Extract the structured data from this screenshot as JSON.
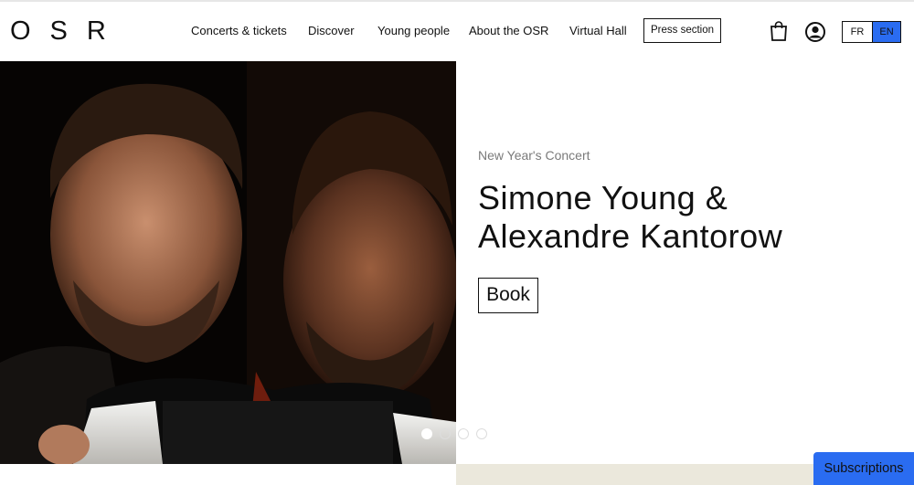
{
  "header": {
    "logo": "OSR",
    "nav": [
      {
        "label": "Concerts & tickets"
      },
      {
        "label": "Discover"
      },
      {
        "label": "Young people"
      },
      {
        "label": "About the OSR"
      },
      {
        "label": "Virtual Hall"
      }
    ],
    "press_label": "Press section",
    "icons": {
      "cart": "shopping-bag-icon",
      "account": "user-account-icon"
    },
    "languages": [
      {
        "code": "FR",
        "selected": false
      },
      {
        "code": "EN",
        "selected": true
      }
    ]
  },
  "hero": {
    "kicker": "New Year's Concert",
    "title": "Simone Young & Alexandre Kantorow",
    "cta_label": "Book",
    "slides_total": 4,
    "slide_active": 1
  },
  "footer_cta": {
    "subscriptions_label": "Subscriptions"
  },
  "colors": {
    "accent": "#2a6cf1",
    "band": "#ebe8dc",
    "text": "#111111",
    "muted": "#7a7a7a"
  }
}
